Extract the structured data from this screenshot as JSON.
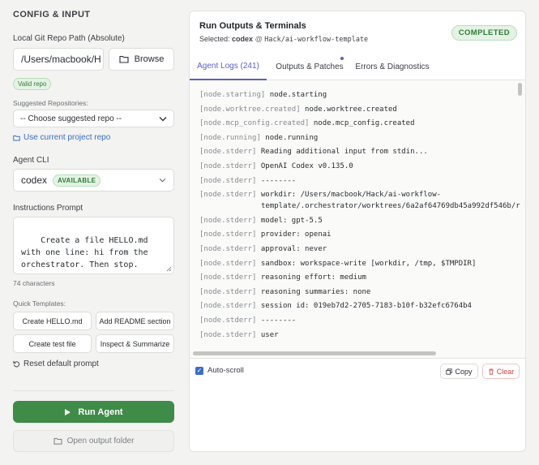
{
  "config": {
    "title": "CONFIG & INPUT",
    "repo_path_label": "Local Git Repo Path (Absolute)",
    "repo_path_value": "/Users/macbook/H",
    "browse_label": "Browse",
    "valid_badge": "Valid repo",
    "suggested_label": "Suggested Repositories:",
    "suggested_placeholder": "-- Choose suggested repo --",
    "use_current_label": "Use current project repo",
    "agent_cli_label": "Agent CLI",
    "agent_cli_value": "codex",
    "agent_cli_badge": "AVAILABLE",
    "prompt_label": "Instructions Prompt",
    "prompt_value": "Create a file HELLO.md with one line: hi from the orchestrator. Then stop.",
    "char_count": "74 characters",
    "quick_templates_label": "Quick Templates:",
    "templates": [
      "Create HELLO.md",
      "Add README section",
      "Create test file",
      "Inspect & Summarize"
    ],
    "reset_label": "Reset default prompt",
    "run_label": "Run Agent",
    "open_output_label": "Open output folder"
  },
  "outputs": {
    "title": "Run Outputs & Terminals",
    "selected_prefix": "Selected:",
    "selected_agent": "codex",
    "selected_at": "@",
    "selected_repo": "Hack/ai-workflow-template",
    "status_badge": "COMPLETED",
    "tabs": [
      "Agent Logs (241)",
      "Outputs & Patches",
      "Errors & Diagnostics"
    ],
    "logs": [
      {
        "tag": "[node.starting]",
        "text": "node.starting"
      },
      {
        "tag": "[node.worktree.created]",
        "text": "node.worktree.created"
      },
      {
        "tag": "[node.mcp_config.created]",
        "text": "node.mcp_config.created"
      },
      {
        "tag": "[node.running]",
        "text": "node.running"
      },
      {
        "tag": "[node.stderr]",
        "text": "Reading additional input from stdin..."
      },
      {
        "tag": "[node.stderr]",
        "text": "OpenAI Codex v0.135.0"
      },
      {
        "tag": "[node.stderr]",
        "text": "--------"
      },
      {
        "tag": "[node.stderr]",
        "text": "workdir: /Users/macbook/Hack/ai-workflow-"
      },
      {
        "tag": "",
        "text": "template/.orchestrator/worktrees/6a2af64769db45a992df546b/r"
      },
      {
        "tag": "[node.stderr]",
        "text": "model: gpt-5.5"
      },
      {
        "tag": "[node.stderr]",
        "text": "provider: openai"
      },
      {
        "tag": "[node.stderr]",
        "text": "approval: never"
      },
      {
        "tag": "[node.stderr]",
        "text": "sandbox: workspace-write [workdir, /tmp, $TMPDIR]"
      },
      {
        "tag": "[node.stderr]",
        "text": "reasoning effort: medium"
      },
      {
        "tag": "[node.stderr]",
        "text": "reasoning summaries: none"
      },
      {
        "tag": "[node.stderr]",
        "text": "session id: 019eb7d2-2705-7183-b10f-b32efc6764b4"
      },
      {
        "tag": "[node.stderr]",
        "text": "--------"
      },
      {
        "tag": "[node.stderr]",
        "text": "user"
      }
    ],
    "autoscroll_label": "Auto-scroll",
    "copy_label": "Copy",
    "clear_label": "Clear"
  }
}
